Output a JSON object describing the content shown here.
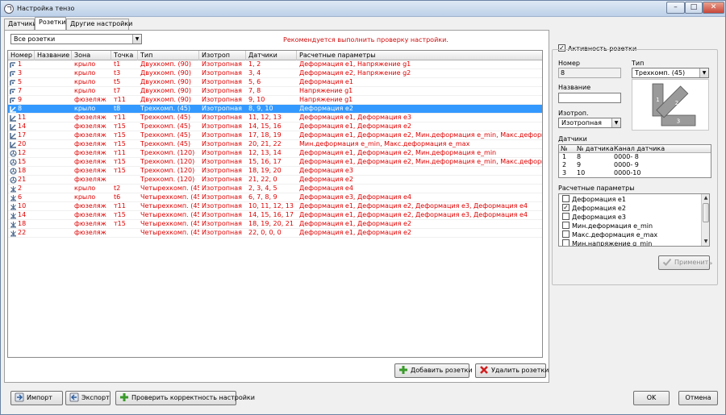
{
  "window": {
    "title": "Настройка тензо",
    "minimize": "–",
    "maximize": "□",
    "close": "✕"
  },
  "tabs": [
    {
      "label": "Датчики"
    },
    {
      "label": "Розетки"
    },
    {
      "label": "Другие настройки"
    }
  ],
  "filter": {
    "value": "Все розетки"
  },
  "warning": "Рекомендуется выполнить проверку настройки.",
  "accent_color": "#3399ff",
  "row_text_color": "#e00000",
  "table": {
    "columns": [
      "Номер",
      "Название",
      "Зона",
      "Точка",
      "Тип",
      "Изотроп",
      "Датчики",
      "Расчетные параметры"
    ],
    "rows": [
      {
        "icon": "rosette-two-component-icon",
        "num": "1",
        "name": "",
        "zone": "крыло",
        "point": "t1",
        "type": "Двухкомп. (90)",
        "iso": "Изотропная",
        "sensors": "1, 2",
        "params": "Деформация е1, Напряжение g1"
      },
      {
        "icon": "rosette-two-component-icon",
        "num": "3",
        "name": "",
        "zone": "крыло",
        "point": "t3",
        "type": "Двухкомп. (90)",
        "iso": "Изотропная",
        "sensors": "3, 4",
        "params": "Деформация е2, Напряжение g2"
      },
      {
        "icon": "rosette-two-component-icon",
        "num": "5",
        "name": "",
        "zone": "крыло",
        "point": "t5",
        "type": "Двухкомп. (90)",
        "iso": "Изотропная",
        "sensors": "5, 6",
        "params": "Деформация е1"
      },
      {
        "icon": "rosette-two-component-icon",
        "num": "7",
        "name": "",
        "zone": "крыло",
        "point": "t7",
        "type": "Двухкомп. (90)",
        "iso": "Изотропная",
        "sensors": "7, 8",
        "params": "Напряжение g1"
      },
      {
        "icon": "rosette-two-component-icon",
        "num": "9",
        "name": "",
        "zone": "фюзеляж",
        "point": "т11",
        "type": "Двухкомп. (90)",
        "iso": "Изотропная",
        "sensors": "9, 10",
        "params": "Напряжение g1"
      },
      {
        "icon": "rosette-three-component-45-icon",
        "num": "8",
        "name": "",
        "zone": "крыло",
        "point": "t8",
        "type": "Трехкомп. (45)",
        "iso": "Изотропная",
        "sensors": "8, 9, 10",
        "params": "Деформация е2",
        "selected": true
      },
      {
        "icon": "rosette-three-component-45-icon",
        "num": "11",
        "name": "",
        "zone": "фюзеляж",
        "point": "т11",
        "type": "Трехкомп. (45)",
        "iso": "Изотропная",
        "sensors": "11, 12, 13",
        "params": "Деформация е1, Деформация е3"
      },
      {
        "icon": "rosette-three-component-45-icon",
        "num": "14",
        "name": "",
        "zone": "фюзеляж",
        "point": "т15",
        "type": "Трехкомп. (45)",
        "iso": "Изотропная",
        "sensors": "14, 15, 16",
        "params": "Деформация е1, Деформация е2"
      },
      {
        "icon": "rosette-three-component-45-icon",
        "num": "17",
        "name": "",
        "zone": "фюзеляж",
        "point": "т15",
        "type": "Трехкомп. (45)",
        "iso": "Изотропная",
        "sensors": "17, 18, 19",
        "params": "Деформация е1, Деформация е2, Мин.деформация е_min, Макс.деформация е_max"
      },
      {
        "icon": "rosette-three-component-45-icon",
        "num": "20",
        "name": "",
        "zone": "фюзеляж",
        "point": "т15",
        "type": "Трехкомп. (45)",
        "iso": "Изотропная",
        "sensors": "20, 21, 22",
        "params": "Мин.деформация е_min, Макс.деформация е_max"
      },
      {
        "icon": "rosette-three-component-120-icon",
        "num": "12",
        "name": "",
        "zone": "фюзеляж",
        "point": "т11",
        "type": "Трехкомп. (120)",
        "iso": "Изотропная",
        "sensors": "12, 13, 14",
        "params": "Деформация е1, Деформация е2, Мин.деформация е_min"
      },
      {
        "icon": "rosette-three-component-120-icon",
        "num": "15",
        "name": "",
        "zone": "фюзеляж",
        "point": "т15",
        "type": "Трехкомп. (120)",
        "iso": "Изотропная",
        "sensors": "15, 16, 17",
        "params": "Деформация е1, Деформация е2, Мин.деформация е_min, Макс.деформация е_max"
      },
      {
        "icon": "rosette-three-component-120-icon",
        "num": "18",
        "name": "",
        "zone": "фюзеляж",
        "point": "т15",
        "type": "Трехкомп. (120)",
        "iso": "Изотропная",
        "sensors": "18, 19, 20",
        "params": "Деформация е3"
      },
      {
        "icon": "rosette-three-component-120-icon",
        "num": "21",
        "name": "",
        "zone": "фюзеляж",
        "point": "",
        "type": "Трехкомп. (120)",
        "iso": "Изотропная",
        "sensors": "21, 22, 0",
        "params": "Деформация е2"
      },
      {
        "icon": "rosette-four-component-icon",
        "num": "2",
        "name": "",
        "zone": "крыло",
        "point": "t2",
        "type": "Четырехкомп. (45)",
        "iso": "Изотропная",
        "sensors": "2, 3, 4, 5",
        "params": "Деформация е4"
      },
      {
        "icon": "rosette-four-component-icon",
        "num": "6",
        "name": "",
        "zone": "крыло",
        "point": "t6",
        "type": "Четырехкомп. (45)",
        "iso": "Изотропная",
        "sensors": "6, 7, 8, 9",
        "params": "Деформация е3, Деформация е4"
      },
      {
        "icon": "rosette-four-component-icon",
        "num": "10",
        "name": "",
        "zone": "фюзеляж",
        "point": "т11",
        "type": "Четырехкомп. (45)",
        "iso": "Изотропная",
        "sensors": "10, 11, 12, 13",
        "params": "Деформация е1, Деформация е2, Деформация е3, Деформация е4"
      },
      {
        "icon": "rosette-four-component-icon",
        "num": "14",
        "name": "",
        "zone": "фюзеляж",
        "point": "т15",
        "type": "Четырехкомп. (45)",
        "iso": "Изотропная",
        "sensors": "14, 15, 16, 17",
        "params": "Деформация е1, Деформация е2, Деформация е3, Деформация е4"
      },
      {
        "icon": "rosette-four-component-icon",
        "num": "18",
        "name": "",
        "zone": "фюзеляж",
        "point": "т15",
        "type": "Четырехкомп. (45)",
        "iso": "Изотропная",
        "sensors": "18, 19, 20, 21",
        "params": "Деформация е1, Деформация е2"
      },
      {
        "icon": "rosette-four-component-icon",
        "num": "22",
        "name": "",
        "zone": "фюзеляж",
        "point": "",
        "type": "Четырехкомп. (45)",
        "iso": "Изотропная",
        "sensors": "22, 0, 0, 0",
        "params": "Деформация е1, Деформация е2"
      }
    ]
  },
  "actions": {
    "add": "Добавить розетки",
    "delete": "Удалить розетки"
  },
  "bottom": {
    "import": "Импорт",
    "export": "Экспорт",
    "check": "Проверить корректность настройки",
    "ok": "OK",
    "cancel": "Отмена"
  },
  "details": {
    "active_label": "Активность розетки",
    "active_checked": true,
    "number_label": "Номер",
    "number_value": "8",
    "type_label": "Тип",
    "type_value": "Трехкомп. (45)",
    "name_label": "Название",
    "name_value": "",
    "iso_label": "Изотроп.",
    "iso_value": "Изотропная",
    "picture_labels": [
      "1",
      "2",
      "3"
    ],
    "sensors_label": "Датчики",
    "sensors_columns": [
      "№",
      "№ датчика",
      "Канал датчика"
    ],
    "sensors": [
      {
        "n": "1",
        "sensor": "8",
        "channel": "0000- 8"
      },
      {
        "n": "2",
        "sensor": "9",
        "channel": "0000- 9"
      },
      {
        "n": "3",
        "sensor": "10",
        "channel": "0000-10"
      }
    ],
    "params_label": "Расчетные параметры",
    "params": [
      {
        "label": "Деформация е1",
        "checked": false
      },
      {
        "label": "Деформация е2",
        "checked": true
      },
      {
        "label": "Деформация е3",
        "checked": false
      },
      {
        "label": "Мин.деформация е_min",
        "checked": false
      },
      {
        "label": "Макс.деформация е_max",
        "checked": false
      },
      {
        "label": "Мин.напряжение g_min",
        "checked": false
      }
    ],
    "apply_label": "Применить"
  }
}
